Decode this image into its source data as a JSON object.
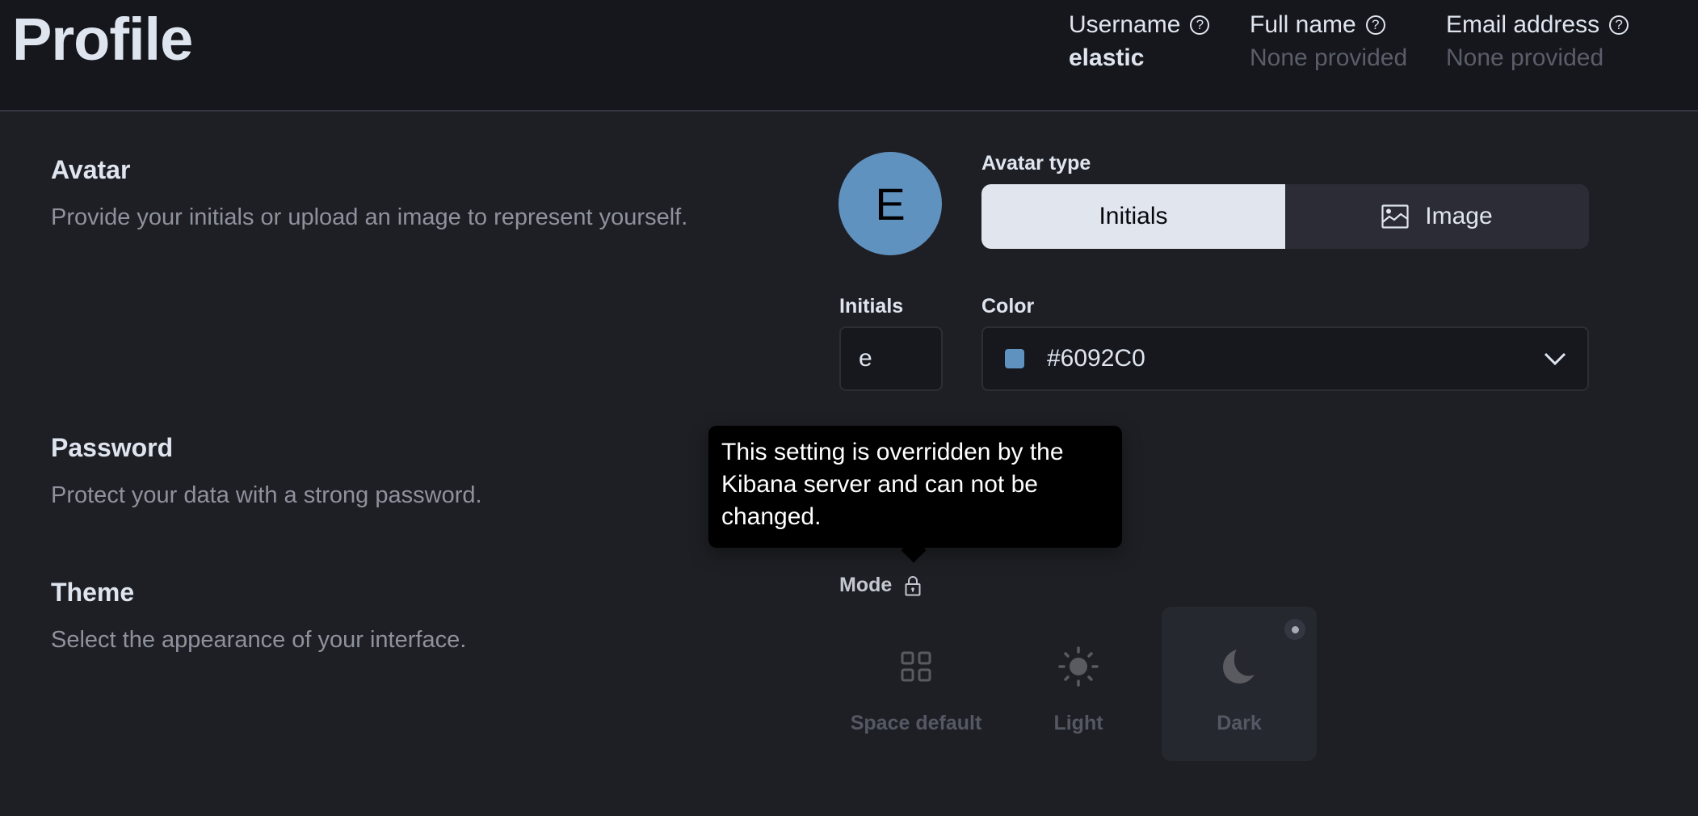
{
  "header": {
    "title": "Profile",
    "fields": [
      {
        "label": "Username",
        "value": "elastic",
        "value_style": "strong"
      },
      {
        "label": "Full name",
        "value": "None provided",
        "value_style": "muted"
      },
      {
        "label": "Email address",
        "value": "None provided",
        "value_style": "muted"
      }
    ],
    "help_icon": "question-circle-icon"
  },
  "avatar_section": {
    "title": "Avatar",
    "description": "Provide your initials or upload an image to represent yourself.",
    "preview_initial": "E",
    "avatar_type_label": "Avatar type",
    "avatar_types": [
      {
        "label": "Initials",
        "selected": true
      },
      {
        "label": "Image",
        "selected": false,
        "icon": "image-icon"
      }
    ],
    "initials_label": "Initials",
    "initials_value": "e",
    "color_label": "Color",
    "color_value": "#6092C0"
  },
  "password_section": {
    "title": "Password",
    "description": "Protect your data with a strong password."
  },
  "theme_section": {
    "title": "Theme",
    "description": "Select the appearance of your interface.",
    "mode_label": "Mode",
    "mode_locked": true,
    "tooltip": "This setting is overridden by the Kibana server and can not be changed.",
    "options": [
      {
        "label": "Space default",
        "icon": "apps-grid-icon",
        "selected": false
      },
      {
        "label": "Light",
        "icon": "sun-icon",
        "selected": false
      },
      {
        "label": "Dark",
        "icon": "moon-icon",
        "selected": true
      }
    ]
  },
  "colors": {
    "avatar_color": "#6092C0",
    "background": "#1E1F24",
    "header_background": "#16171C",
    "tooltip_background": "#000000"
  }
}
